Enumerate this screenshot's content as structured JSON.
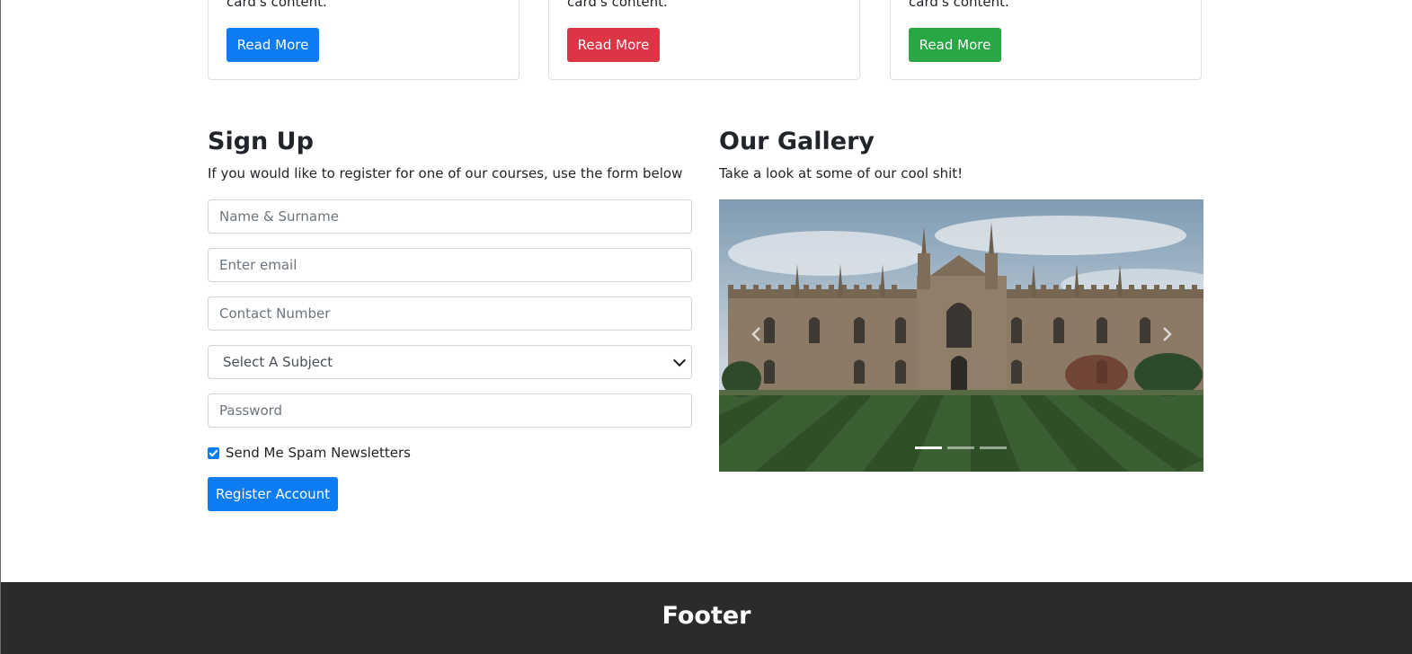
{
  "cards": [
    {
      "text": "card's content.",
      "button": "Read More",
      "color": "#0d7cf2"
    },
    {
      "text": "card's content.",
      "button": "Read More",
      "color": "#dc3545"
    },
    {
      "text": "card's content.",
      "button": "Read More",
      "color": "#28a745"
    }
  ],
  "signup": {
    "title": "Sign Up",
    "subtitle": "If you would like to register for one of our courses, use the form below",
    "name_placeholder": "Name & Surname",
    "email_placeholder": "Enter email",
    "contact_placeholder": "Contact Number",
    "subject_selected": "Select A Subject",
    "password_placeholder": "Password",
    "newsletter_label": "Send Me Spam Newsletters",
    "newsletter_checked": true,
    "submit_label": "Register Account"
  },
  "gallery": {
    "title": "Our Gallery",
    "subtitle": "Take a look at some of our cool shit!",
    "slide_count": 3,
    "active_slide": 1,
    "image": "gothic-college-building-with-striped-lawn"
  },
  "footer": {
    "title": "Footer"
  },
  "colors": {
    "primary": "#0d7cf2",
    "danger": "#dc3545",
    "success": "#28a745",
    "footer_bg": "#2b2b2b"
  }
}
